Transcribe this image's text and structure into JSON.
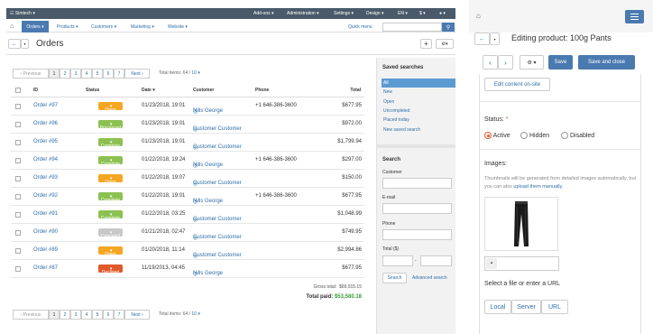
{
  "topbar": {
    "brand": "Simtech",
    "menus": [
      "Add-ons",
      "Administration",
      "Settings",
      "Design",
      "EN",
      "$"
    ]
  },
  "nav": {
    "items": [
      "Orders",
      "Products",
      "Customers",
      "Marketing",
      "Website"
    ],
    "quick_menu": "Quick menu"
  },
  "page": {
    "title": "Orders"
  },
  "pagination": {
    "previous": "Previous",
    "pages": [
      "1",
      "2",
      "3",
      "4",
      "5",
      "6",
      "7"
    ],
    "next": "Next",
    "total_label": "Total items: 64 /",
    "per_page": "10"
  },
  "table": {
    "headers": {
      "id": "ID",
      "status": "Status",
      "date": "Date",
      "customer": "Customer",
      "phone": "Phone",
      "total": "Total"
    },
    "rows": [
      {
        "id": "Order #97",
        "status": "Open",
        "status_class": "open",
        "date": "01/23/2018, 19:01",
        "customer": "Nills George",
        "phone": "+1 646-386-3600",
        "total": "$677.95"
      },
      {
        "id": "Order #96",
        "status": "Processed",
        "status_class": "processed",
        "date": "01/23/2018, 19:01",
        "customer": "Customer Customer",
        "phone": "",
        "total": "$972.00"
      },
      {
        "id": "Order #95",
        "status": "Complete",
        "status_class": "complete",
        "date": "01/23/2018, 19:01",
        "customer": "Customer Customer",
        "phone": "",
        "total": "$1,799.94"
      },
      {
        "id": "Order #94",
        "status": "Complete",
        "status_class": "complete",
        "date": "01/22/2018, 19:24",
        "customer": "Nills George",
        "phone": "+1 646-386-3600",
        "total": "$297.00"
      },
      {
        "id": "Order #93",
        "status": "Open",
        "status_class": "open",
        "date": "01/22/2018, 19:07",
        "customer": "Customer Customer",
        "phone": "",
        "total": "$150.00"
      },
      {
        "id": "Order #92",
        "status": "Complete",
        "status_class": "complete",
        "date": "01/22/2018, 19:01",
        "customer": "Nills George",
        "phone": "+1 646-386-3600",
        "total": "$677.95"
      },
      {
        "id": "Order #91",
        "status": "Complete",
        "status_class": "complete",
        "date": "01/22/2018, 03:25",
        "customer": "Customer Customer",
        "phone": "",
        "total": "$1,048.99"
      },
      {
        "id": "Order #90",
        "status": "Canceled",
        "status_class": "canceled",
        "date": "01/21/2018, 02:47",
        "customer": "Customer Customer",
        "phone": "",
        "total": "$749.95"
      },
      {
        "id": "Order #89",
        "status": "Open",
        "status_class": "open",
        "date": "01/20/2018, 11:14",
        "customer": "Customer Customer",
        "phone": "",
        "total": "$2,994.86"
      },
      {
        "id": "Order #87",
        "status": "Declined",
        "status_class": "declined",
        "date": "11/19/2013, 04:45",
        "customer": "Nills George",
        "phone": "",
        "total": "$677.95"
      }
    ]
  },
  "totals": {
    "gross_label": "Gross total:",
    "gross_value": "$69,915.15",
    "paid_label": "Total paid:",
    "paid_value": "$53,580.18"
  },
  "saved_searches": {
    "title": "Saved searches",
    "items": [
      "All",
      "New",
      "Open",
      "Uncompleted",
      "Placed today",
      "New saved search"
    ]
  },
  "search": {
    "title": "Search",
    "customer_label": "Customer",
    "email_label": "E-mail",
    "phone_label": "Phone",
    "total_label": "Total ($)",
    "search_button": "Search",
    "advanced_link": "Advanced search"
  },
  "product": {
    "title": "Editing product: 100g Pants",
    "save": "Save",
    "save_close": "Save and close",
    "edit_onsite": "Edit content on-site",
    "status_label": "Status:",
    "status_required": "*",
    "status_options": [
      "Active",
      "Hidden",
      "Disabled"
    ],
    "status_selected": "Active",
    "images_label": "Images:",
    "images_hint": "Thumbnails will be generated from detailed images automatically, but you can also",
    "images_hint_link": "upload them manually.",
    "file_label": "Select a file or enter a URL",
    "file_buttons": [
      "Local",
      "Server",
      "URL"
    ]
  }
}
